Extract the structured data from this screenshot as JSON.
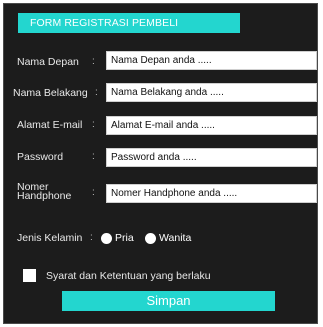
{
  "form": {
    "title": "FORM REGISTRASI PEMBELI",
    "colon": ":",
    "fields": [
      {
        "label": "Nama Depan",
        "value": "Nama Depan anda ....."
      },
      {
        "label": "Nama Belakang",
        "value": "Nama Belakang anda ....."
      },
      {
        "label": "Alamat E-mail",
        "value": "Alamat E-mail anda ....."
      },
      {
        "label": "Password",
        "value": "Password anda ....."
      },
      {
        "label_line1": "Nomer",
        "label_line2": "Handphone",
        "value": "Nomer Handphone anda ....."
      }
    ],
    "gender": {
      "label": "Jenis Kelamin",
      "options": [
        "Pria",
        "Wanita"
      ]
    },
    "terms_label": "Syarat dan Ketentuan yang berlaku",
    "submit_label": "Simpan"
  },
  "colors": {
    "accent": "#23d6cf",
    "panel_bg": "#1c1c1c"
  }
}
